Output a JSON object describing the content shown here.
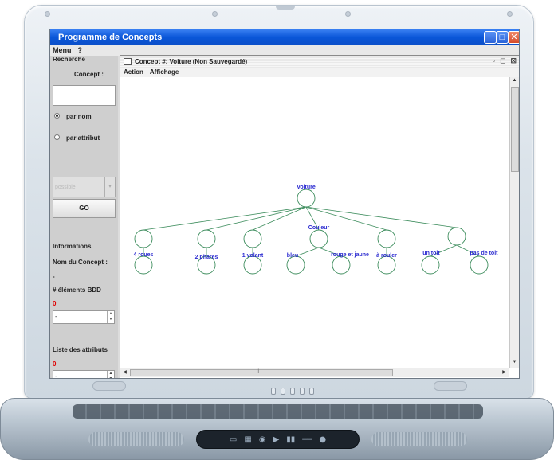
{
  "app": {
    "window_title": "Programme de Concepts",
    "controls": {
      "minimize": "_",
      "maximize": "□",
      "close": "✕"
    },
    "menu": [
      "Menu",
      "?"
    ]
  },
  "left_panel": {
    "search_header": "Recherche",
    "concept_label": "Concept :",
    "concept_value": "",
    "radio_by_name": "par nom",
    "radio_by_attribute": "par attribut",
    "radio_selected": "par nom",
    "combo_value": "possible",
    "go_button": "GO",
    "info_header": "Informations",
    "concept_name_label": "Nom du Concept :",
    "concept_name_value": "-",
    "count_label": "# éléments BDD",
    "count_value": "0",
    "count_spinner_value": "-",
    "attributes_label": "Liste des attributs",
    "attributes_count": "0",
    "attributes_spinner_value": "-"
  },
  "internal_frame": {
    "title": "Concept #: Voiture (Non Sauvegardé)",
    "menu": [
      "Action",
      "Affichage"
    ],
    "buttons": [
      "▫",
      "◻",
      "⊠"
    ],
    "scroll_label": "ll"
  },
  "chart_data": {
    "type": "tree",
    "root": "Voiture",
    "nodes": [
      {
        "id": "voiture",
        "label": "Voiture",
        "parent": null
      },
      {
        "id": "roues",
        "label": "4 roues",
        "parent": "voiture"
      },
      {
        "id": "phares",
        "label": "2 phares",
        "parent": "voiture"
      },
      {
        "id": "volant",
        "label": "1 volant",
        "parent": "voiture"
      },
      {
        "id": "couleur",
        "label": "Couleur",
        "parent": "voiture"
      },
      {
        "id": "bleu",
        "label": "bleu",
        "parent": "couleur"
      },
      {
        "id": "rouge",
        "label": "rouge et jaune",
        "parent": "couleur"
      },
      {
        "id": "rouler",
        "label": "à rouler",
        "parent": "voiture"
      },
      {
        "id": "toit",
        "label": "",
        "parent": "voiture"
      },
      {
        "id": "untoit",
        "label": "un toit",
        "parent": "toit"
      },
      {
        "id": "pastoit",
        "label": "pas de toit",
        "parent": "toit"
      }
    ],
    "colors": {
      "node_stroke": "#3c8c5c",
      "edge": "#3c8c5c",
      "label": "#2a2ad0"
    }
  },
  "taskbar_leds": [
    "⊙",
    "▭",
    "◎",
    "⊕",
    "⊕"
  ],
  "media_icons": [
    "▭",
    "▦",
    "◉",
    "▶",
    "▮▮",
    "━━",
    "●"
  ]
}
